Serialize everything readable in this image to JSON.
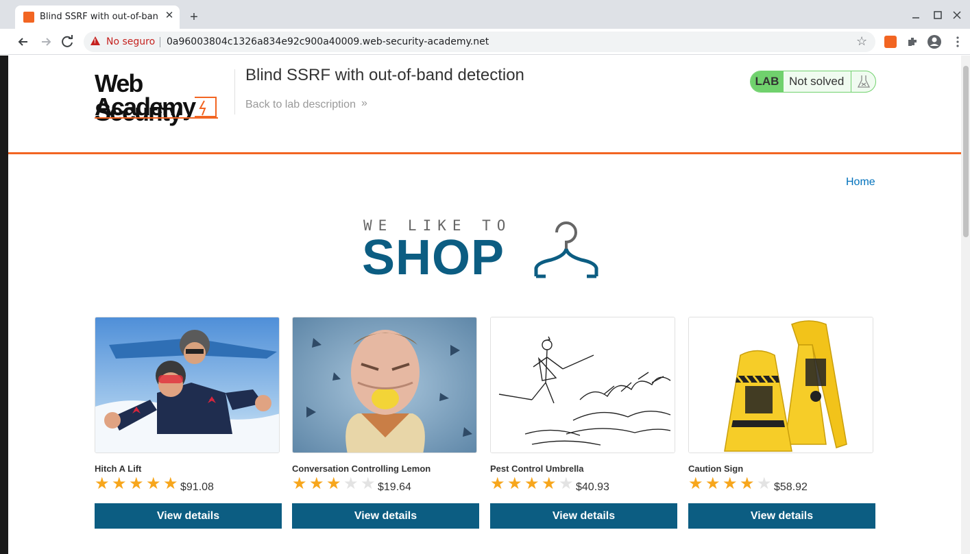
{
  "browser": {
    "tab_title": "Blind SSRF with out-of-band detection",
    "tab_close": "✕",
    "new_tab": "+",
    "security_label": "No seguro",
    "url": "0a96003804c1326a834e92c900a40009.web-security-academy.net",
    "icons": [
      "back-icon",
      "forward-icon",
      "reload-icon",
      "warning-icon",
      "star-icon",
      "extension-icon",
      "puzzle-icon",
      "profile-icon",
      "menu-icon"
    ]
  },
  "header": {
    "logo_line1": "Web Security",
    "logo_line2": "Academy",
    "lab_title": "Blind SSRF with out-of-band detection",
    "back_link": "Back to lab description",
    "back_chevron": "»",
    "lab_tag": "LAB",
    "lab_status": "Not solved"
  },
  "nav": {
    "home": "Home"
  },
  "banner": {
    "small_text": "WE LIKE TO",
    "big_text": "SHOP"
  },
  "colors": {
    "accent_orange": "#f26522",
    "brand_blue": "#0c5d82",
    "lab_green": "#70d16d",
    "star_filled": "#f7a61c",
    "star_empty": "#e3e3e3"
  },
  "products": [
    {
      "name": "Hitch A Lift",
      "rating": 5,
      "price": "$91.08",
      "button": "View details"
    },
    {
      "name": "Conversation Controlling Lemon",
      "rating": 3,
      "price": "$19.64",
      "button": "View details"
    },
    {
      "name": "Pest Control Umbrella",
      "rating": 4,
      "price": "$40.93",
      "button": "View details"
    },
    {
      "name": "Caution Sign",
      "rating": 4,
      "price": "$58.92",
      "button": "View details"
    }
  ]
}
